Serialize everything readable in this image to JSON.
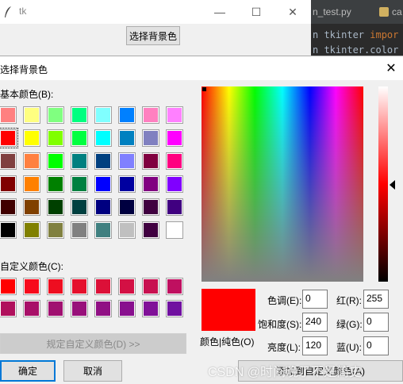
{
  "tk_window": {
    "title": "tk",
    "button_label": "选择背景色",
    "minimize_glyph": "—",
    "maximize_glyph": "☐",
    "close_glyph": "✕"
  },
  "editor": {
    "tab1": "n_test.py",
    "tab2": "ca",
    "line1_prefix": "n tkinter ",
    "line1_keyword": "impor",
    "line2": "n tkinter.color"
  },
  "dialog": {
    "title": "选择背景色",
    "close_glyph": "✕",
    "basic_colors_label": "基本颜色(B):",
    "custom_colors_label": "自定义颜色(C):",
    "define_custom_label": "规定自定义颜色(D) >>",
    "ok_label": "确定",
    "cancel_label": "取消",
    "add_custom_label": "添加到自定义颜色(A)",
    "color_solid_label": "颜色|纯色(O)",
    "hue_label": "色调(E):",
    "hue_value": "0",
    "sat_label": "饱和度(S):",
    "sat_value": "240",
    "lum_label": "亮度(L):",
    "lum_value": "120",
    "red_label": "红(R):",
    "red_value": "255",
    "green_label": "绿(G):",
    "green_value": "0",
    "blue_label": "蓝(U):",
    "blue_value": "0",
    "selected_color": "#ff0000",
    "basic_colors": [
      [
        "#ff8080",
        "#ffff80",
        "#80ff80",
        "#00ff80",
        "#80ffff",
        "#0080ff",
        "#ff80c0",
        "#ff80ff"
      ],
      [
        "#ff0000",
        "#ffff00",
        "#80ff00",
        "#00ff40",
        "#00ffff",
        "#0080c0",
        "#8080c0",
        "#ff00ff"
      ],
      [
        "#804040",
        "#ff8040",
        "#00ff00",
        "#008080",
        "#004080",
        "#8080ff",
        "#800040",
        "#ff0080"
      ],
      [
        "#800000",
        "#ff8000",
        "#008000",
        "#008040",
        "#0000ff",
        "#0000a0",
        "#800080",
        "#8000ff"
      ],
      [
        "#400000",
        "#804000",
        "#004000",
        "#004040",
        "#000080",
        "#000040",
        "#400040",
        "#400080"
      ],
      [
        "#000000",
        "#808000",
        "#808040",
        "#808080",
        "#408080",
        "#c0c0c0",
        "#400040",
        "#ffffff"
      ]
    ],
    "custom_colors": [
      [
        "#ff0000",
        "#f70a1c",
        "#ee0e20",
        "#e5102c",
        "#dc1038",
        "#d31044",
        "#c81050",
        "#bf1060"
      ],
      [
        "#b0105c",
        "#a81068",
        "#a01070",
        "#98107a",
        "#901084",
        "#88108e",
        "#801098",
        "#7010a0"
      ]
    ]
  },
  "watermark": "CSDN @时间晚了不是简史"
}
